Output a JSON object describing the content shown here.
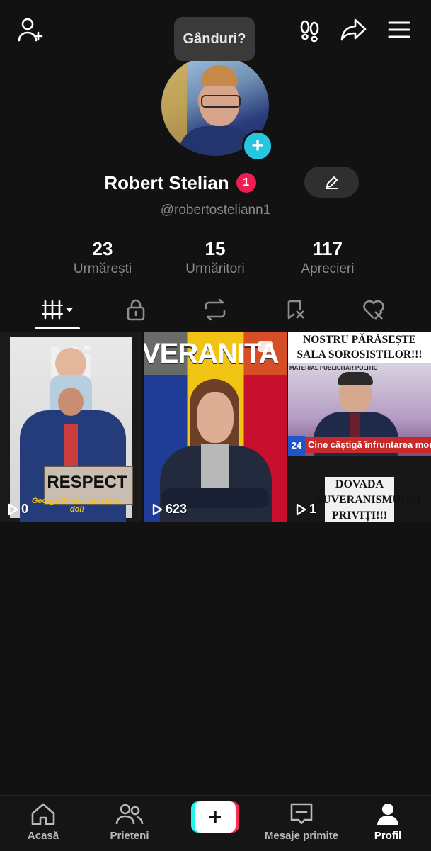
{
  "header": {
    "thought_bubble": "Gânduri?"
  },
  "profile": {
    "display_name": "Robert Stelian",
    "notification_count": "1",
    "username": "@robertosteliann1"
  },
  "stats": [
    {
      "value": "23",
      "label": "Urmărești"
    },
    {
      "value": "15",
      "label": "Urmăritori"
    },
    {
      "value": "117",
      "label": "Aprecieri"
    }
  ],
  "tabs": [
    {
      "icon": "videos-grid-icon",
      "active": true
    },
    {
      "icon": "lock-icon",
      "active": false
    },
    {
      "icon": "repost-icon",
      "active": false
    },
    {
      "icon": "favorites-icon",
      "active": false
    },
    {
      "icon": "liked-icon",
      "active": false
    }
  ],
  "videos": [
    {
      "title": "RESPECT",
      "caption": "George Simion și-n turul doi!",
      "views": "0"
    },
    {
      "title": "VERANITA",
      "caption": "",
      "views": "623"
    },
    {
      "title": "NOSTRU PĂRĂSEȘTE SALA SOROSISTILOR!!!",
      "ticker_top": "MATERIAL PUBLICITAR POLITIC",
      "ticker_bottom": "Cine câștigă înfruntarea momentului",
      "channel": "24",
      "caption": "DOVADA SUVERANISMULUI PRIVIȚI!!!",
      "views": "1"
    }
  ],
  "nav": [
    {
      "label": "Acasă",
      "icon": "home-icon"
    },
    {
      "label": "Prieteni",
      "icon": "friends-icon"
    },
    {
      "label": "",
      "icon": "create-plus-icon"
    },
    {
      "label": "Mesaje primite",
      "icon": "inbox-icon"
    },
    {
      "label": "Profil",
      "icon": "profile-icon",
      "active": true
    }
  ],
  "colors": {
    "accent_cyan": "#25c6e0",
    "badge_red": "#ee1d52",
    "background": "#121212"
  }
}
